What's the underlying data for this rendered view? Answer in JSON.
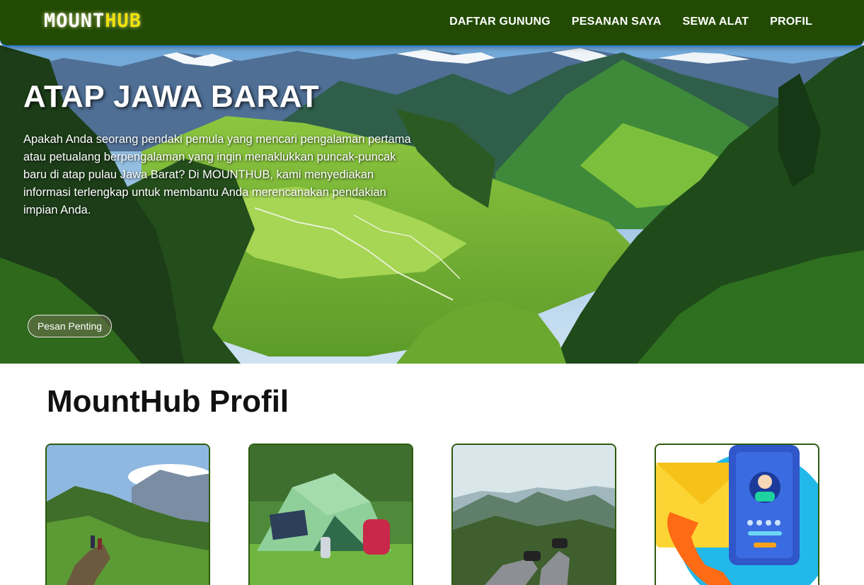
{
  "brand": {
    "part1": "MOUNT",
    "part2": "HUB"
  },
  "nav": {
    "items": [
      {
        "label": "DAFTAR GUNUNG"
      },
      {
        "label": "PESANAN SAYA"
      },
      {
        "label": "SEWA ALAT"
      },
      {
        "label": "PROFIL"
      }
    ]
  },
  "hero": {
    "title": "ATAP JAWA BARAT",
    "description": "Apakah Anda seorang pendaki pemula yang mencari pengalaman pertama atau petualang berpengalaman yang ingin menaklukkan puncak-puncak baru di atap pulau Jawa Barat? Di MOUNTHUB, kami menyediakan informasi terlengkap untuk membantu Anda merencanakan pendakian impian Anda.",
    "button_label": "Pesan Penting"
  },
  "profile": {
    "title": "MountHub Profil",
    "cards": [
      {
        "image": "hikers-on-mountain-trail"
      },
      {
        "image": "camping-tent-with-backpack"
      },
      {
        "image": "legs-over-mountain-view"
      },
      {
        "image": "contact-phone-mail-icon"
      }
    ]
  },
  "colors": {
    "navbar": "#224a02",
    "brand_accent": "#f2e207",
    "card_border": "#2d5a0e"
  }
}
